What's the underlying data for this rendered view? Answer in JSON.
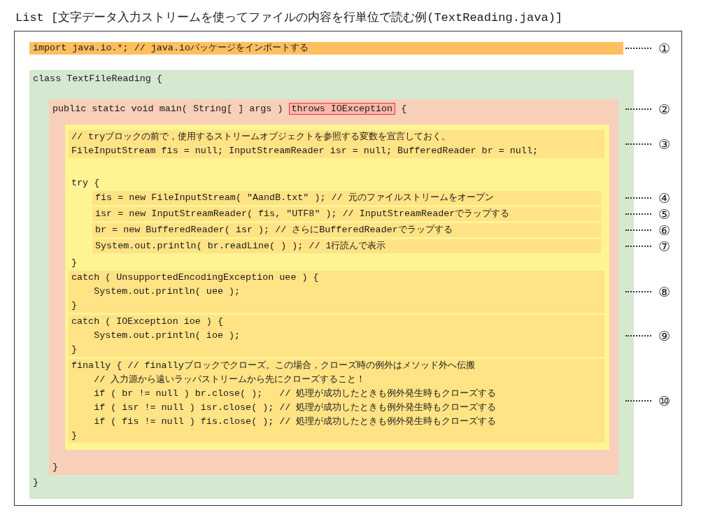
{
  "title": "List [文字データ入力ストリームを使ってファイルの内容を行単位で読む例(TextReading.java)]",
  "import_line": {
    "text": "import java.io.*; // java.ioパッケージをインポートする",
    "callout": "①"
  },
  "class_block": {
    "header": "class TextFileReading {",
    "footer": "}",
    "method_block": {
      "header_before": "public static void main( String[ ] args ) ",
      "header_highlight": "throws IOException",
      "header_after": " {",
      "callout": "②",
      "footer": "}",
      "body": [
        {
          "kind": "group",
          "callout": "③",
          "lines": [
            "// tryブロックの前で，使用するストリームオブジェクトを参照する変数を宣言しておく。",
            "FileInputStream fis = null; InputStreamReader isr = null; BufferedReader br = null;"
          ]
        },
        {
          "kind": "blank"
        },
        {
          "kind": "block",
          "open": "try {",
          "close": "}",
          "children": [
            {
              "kind": "group",
              "callout": "④",
              "lines": [
                "fis = new FileInputStream( \"AandB.txt\" ); // 元のファイルストリームをオープン"
              ]
            },
            {
              "kind": "group",
              "callout": "⑤",
              "lines": [
                "isr = new InputStreamReader( fis, \"UTF8\" ); // InputStreamReaderでラップする"
              ]
            },
            {
              "kind": "group",
              "callout": "⑥",
              "lines": [
                "br = new BufferedReader( isr ); // さらにBufferedReaderでラップする"
              ]
            },
            {
              "kind": "group",
              "callout": "⑦",
              "lines": [
                "System.out.println( br.readLine( ) ); // 1行読んで表示"
              ]
            }
          ]
        },
        {
          "kind": "group",
          "callout": "⑧",
          "lines": [
            "catch ( UnsupportedEncodingException uee ) {",
            "    System.out.println( uee );",
            "}"
          ]
        },
        {
          "kind": "group",
          "callout": "⑨",
          "lines": [
            "catch ( IOException ioe ) {",
            "    System.out.println( ioe );",
            "}"
          ]
        },
        {
          "kind": "group",
          "callout": "⑩",
          "lines": [
            "finally { // finallyブロックでクローズ。この場合，クローズ時の例外はメソッド外へ伝搬",
            "    // 入力源から遠いラッパストリームから先にクローズすること！",
            "    if ( br != null ) br.close( );   // 処理が成功したときも例外発生時もクローズする",
            "    if ( isr != null ) isr.close( ); // 処理が成功したときも例外発生時もクローズする",
            "    if ( fis != null ) fis.close( ); // 処理が成功したときも例外発生時もクローズする",
            "}"
          ]
        }
      ]
    }
  }
}
